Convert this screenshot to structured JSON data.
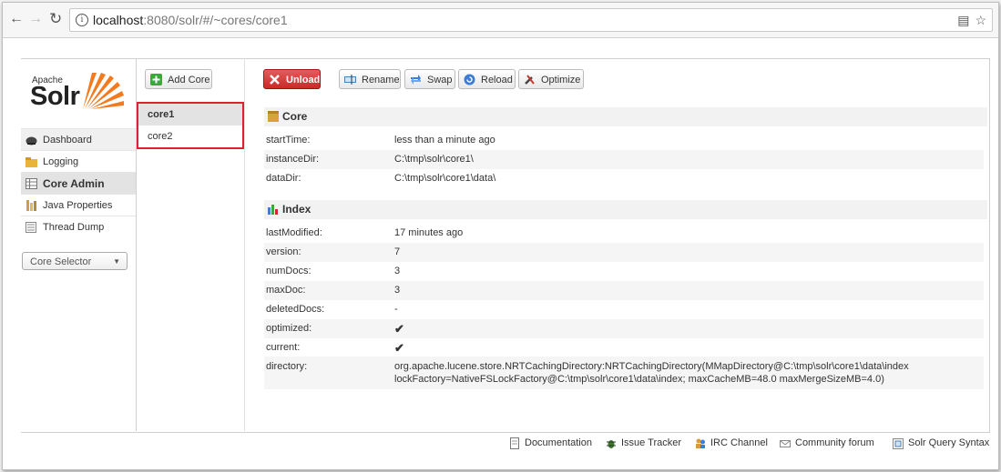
{
  "browser": {
    "url_host": "localhost",
    "url_rest": ":8080/solr/#/~cores/core1",
    "translate_icon": "translate-icon",
    "star_icon": "star-icon"
  },
  "logo": {
    "apache": "Apache",
    "solr": "Solr"
  },
  "sidebar": {
    "items": [
      {
        "label": "Dashboard",
        "icon": "dashboard-icon"
      },
      {
        "label": "Logging",
        "icon": "logging-icon"
      },
      {
        "label": "Core Admin",
        "icon": "core-admin-icon"
      },
      {
        "label": "Java Properties",
        "icon": "java-properties-icon"
      },
      {
        "label": "Thread Dump",
        "icon": "thread-dump-icon"
      }
    ],
    "core_selector": "Core Selector"
  },
  "toolbar": {
    "add_core": "Add Core",
    "unload": "Unload",
    "rename": "Rename",
    "swap": "Swap",
    "reload": "Reload",
    "optimize": "Optimize"
  },
  "cores": [
    "core1",
    "core2"
  ],
  "core_section": {
    "title": "Core",
    "rows": [
      {
        "key": "startTime:",
        "value": "less than a minute ago"
      },
      {
        "key": "instanceDir:",
        "value": "C:\\tmp\\solr\\core1\\"
      },
      {
        "key": "dataDir:",
        "value": "C:\\tmp\\solr\\core1\\data\\"
      }
    ]
  },
  "index_section": {
    "title": "Index",
    "rows": [
      {
        "key": "lastModified:",
        "value": "17 minutes ago"
      },
      {
        "key": "version:",
        "value": "7"
      },
      {
        "key": "numDocs:",
        "value": "3"
      },
      {
        "key": "maxDoc:",
        "value": "3"
      },
      {
        "key": "deletedDocs:",
        "value": "-"
      },
      {
        "key": "optimized:",
        "value": "✔"
      },
      {
        "key": "current:",
        "value": "✔"
      },
      {
        "key": "directory:",
        "value": "org.apache.lucene.store.NRTCachingDirectory:NRTCachingDirectory(MMapDirectory@C:\\tmp\\solr\\core1\\data\\index lockFactory=NativeFSLockFactory@C:\\tmp\\solr\\core1\\data\\index; maxCacheMB=48.0 maxMergeSizeMB=4.0)"
      }
    ]
  },
  "footer": {
    "documentation": "Documentation",
    "issue_tracker": "Issue Tracker",
    "irc_channel": "IRC Channel",
    "community_forum": "Community forum",
    "query_syntax": "Solr Query Syntax"
  }
}
